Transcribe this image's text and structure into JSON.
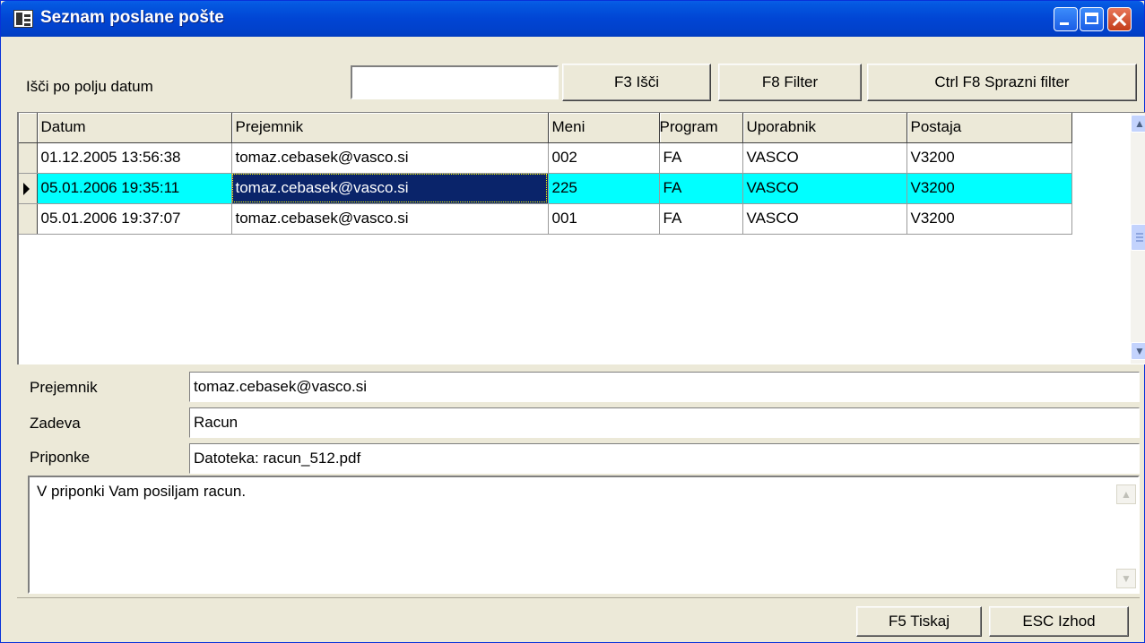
{
  "window": {
    "title": "Seznam poslane pošte"
  },
  "toolbar": {
    "search_label": "Išči po polju datum",
    "search_value": "",
    "f3_label": "F3 Išči",
    "f8_label": "F8 Filter",
    "clear_label": "Ctrl F8 Sprazni filter"
  },
  "grid": {
    "columns": [
      "Datum",
      "Prejemnik",
      "Meni",
      "Program",
      "Uporabnik",
      "Postaja"
    ],
    "rows": [
      {
        "datum": "01.12.2005 13:56:38",
        "prejemnik": "tomaz.cebasek@vasco.si",
        "meni": "002",
        "program": "FA",
        "uporabnik": "VASCO",
        "postaja": "V3200"
      },
      {
        "datum": "05.01.2006 19:35:11",
        "prejemnik": "tomaz.cebasek@vasco.si",
        "meni": "225",
        "program": "FA",
        "uporabnik": "VASCO",
        "postaja": "V3200"
      },
      {
        "datum": "05.01.2006 19:37:07",
        "prejemnik": "tomaz.cebasek@vasco.si",
        "meni": "001",
        "program": "FA",
        "uporabnik": "VASCO",
        "postaja": "V3200"
      }
    ],
    "selected_row": 2,
    "selection_color": "#00ffff",
    "focus_color": "#0a246a"
  },
  "detail": {
    "recipient_label": "Prejemnik",
    "recipient_value": "tomaz.cebasek@vasco.si",
    "subject_label": "Zadeva",
    "subject_value": "Racun",
    "attachments_label": "Priponke",
    "attachments_value": "Datoteka: racun_512.pdf",
    "body": "V priponki Vam posiljam racun."
  },
  "footer": {
    "print_label": "F5 Tiskaj",
    "exit_label": "ESC Izhod"
  },
  "icons": [
    "app-window-icon",
    "minimize-icon",
    "maximize-icon",
    "close-icon",
    "row-indicator-arrow-icon",
    "scroll-up-icon",
    "scroll-down-icon"
  ]
}
